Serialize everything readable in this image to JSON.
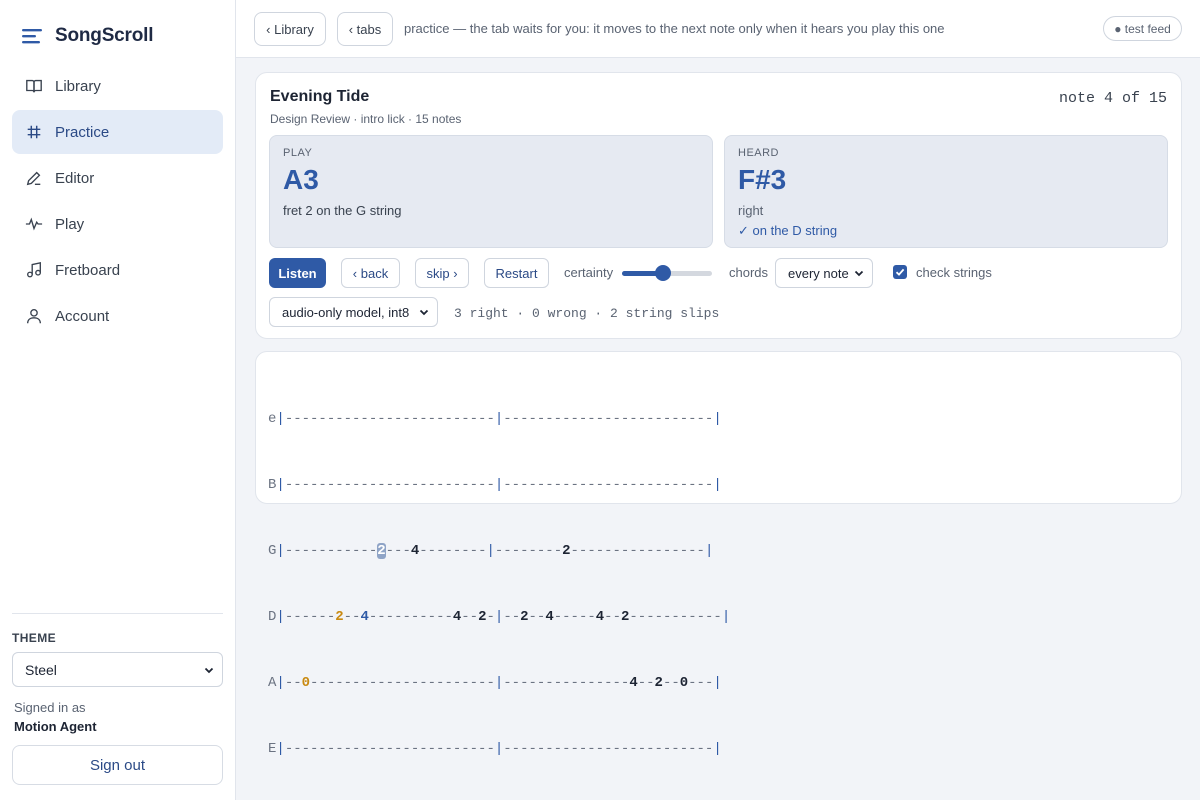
{
  "app": {
    "name": "SongScroll"
  },
  "sidebar": {
    "items": [
      {
        "label": "Library",
        "icon": "book-icon",
        "active": false
      },
      {
        "label": "Practice",
        "icon": "grid-icon",
        "active": true
      },
      {
        "label": "Editor",
        "icon": "pencil-icon",
        "active": false
      },
      {
        "label": "Play",
        "icon": "waveform-icon",
        "active": false
      },
      {
        "label": "Fretboard",
        "icon": "music-note-icon",
        "active": false
      },
      {
        "label": "Account",
        "icon": "user-icon",
        "active": false
      }
    ],
    "theme_label": "THEME",
    "theme_value": "Steel",
    "signed_in_label": "Signed in as",
    "signed_in_name": "Motion Agent",
    "signout_label": "Sign out"
  },
  "topbar": {
    "library_btn": "‹ Library",
    "tabs_btn": "‹ tabs",
    "hint": "practice — the tab waits for you: it moves to the next note only when it hears you play this one",
    "test_feed": "● test feed"
  },
  "practice": {
    "song_title": "Evening Tide",
    "song_sub": "Design Review · intro lick · 15 notes",
    "note_count": "note 4 of 15",
    "play": {
      "caption": "PLAY",
      "note": "A3",
      "detail": "fret 2 on the G string"
    },
    "heard": {
      "caption": "HEARD",
      "note": "F#3",
      "verdict": "right",
      "string_check": "✓ on the D string"
    },
    "controls": {
      "listen": "Listen",
      "back": "‹ back",
      "skip": "skip ›",
      "restart": "Restart",
      "certainty_label": "certainty",
      "certainty_value": 0.45,
      "chords_label": "chords",
      "chords_value": "every note",
      "check_strings_label": "check strings",
      "check_strings_checked": true,
      "model_value": "audio-only model, int8"
    },
    "stats": "3 right · 0 wrong · 2 string slips"
  },
  "tab": {
    "lines": [
      {
        "string": "e",
        "text": "|-------------------------|-------------------------|"
      },
      {
        "string": "B",
        "text": "|-------------------------|-------------------------|"
      },
      {
        "string": "G",
        "text": "|-----------2---4--------|--------2----------------|"
      },
      {
        "string": "D",
        "text": "|------2--4----------4--2-|--2--4-----4--2-----------|"
      },
      {
        "string": "A",
        "text": "|--0----------------------|---------------4--2--0---|"
      },
      {
        "string": "E",
        "text": "|-------------------------|-------------------------|"
      }
    ]
  },
  "colors": {
    "accent": "#2f5aa6",
    "played_note": "#c98a12",
    "current_note_bg": "#8fa4c7"
  }
}
